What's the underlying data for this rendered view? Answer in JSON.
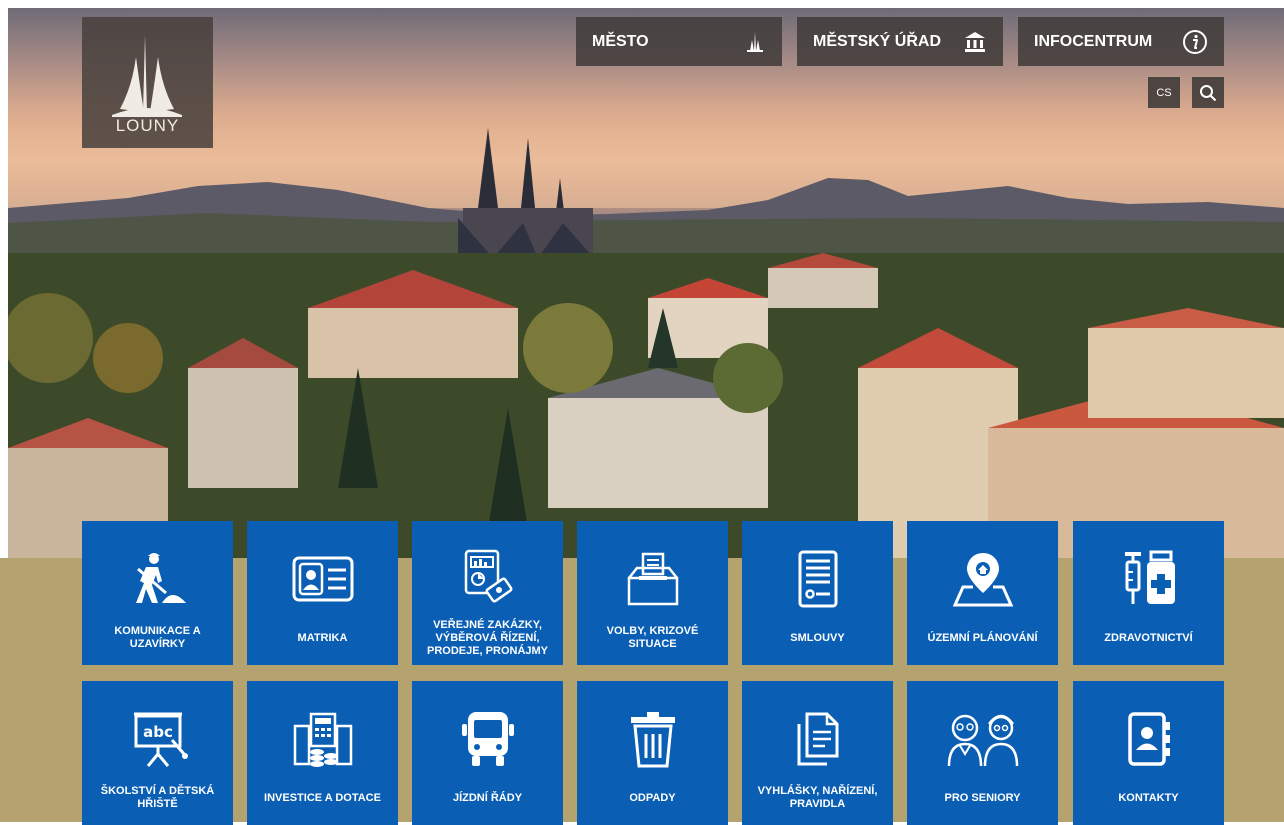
{
  "logo": {
    "text": "LOUNY"
  },
  "nav": [
    {
      "label": "MĚSTO",
      "icon": "cathedral-icon"
    },
    {
      "label": "MĚSTSKÝ ÚŘAD",
      "icon": "town-hall-icon"
    },
    {
      "label": "INFOCENTRUM",
      "icon": "info-icon"
    }
  ],
  "lang": {
    "label": "CS"
  },
  "colors": {
    "tile": "#0a5fb4",
    "band": "#b4a36f"
  },
  "tiles": [
    {
      "label": "KOMUNIKACE A UZAVÍRKY",
      "icon": "road-worker-icon"
    },
    {
      "label": "MATRIKA",
      "icon": "id-card-icon"
    },
    {
      "label": "VEŘEJNÉ ZAKÁZKY, VÝBĚROVÁ ŘÍZENÍ, PRODEJE, PRONÁJMY",
      "icon": "report-icon"
    },
    {
      "label": "VOLBY, KRIZOVÉ SITUACE",
      "icon": "ballot-box-icon"
    },
    {
      "label": "SMLOUVY",
      "icon": "contract-icon"
    },
    {
      "label": "ÚZEMNÍ PLÁNOVÁNÍ",
      "icon": "map-pin-icon"
    },
    {
      "label": "ZDRAVOTNICTVÍ",
      "icon": "medicine-icon"
    },
    {
      "label": "ŠKOLSTVÍ A DĚTSKÁ HŘIŠTĚ",
      "icon": "blackboard-icon"
    },
    {
      "label": "INVESTICE A DOTACE",
      "icon": "investment-icon"
    },
    {
      "label": "JÍZDNÍ ŘÁDY",
      "icon": "bus-icon"
    },
    {
      "label": "ODPADY",
      "icon": "trash-bin-icon"
    },
    {
      "label": "VYHLÁŠKY, NAŘÍZENÍ, PRAVIDLA",
      "icon": "documents-icon"
    },
    {
      "label": "PRO SENIORY",
      "icon": "seniors-icon"
    },
    {
      "label": "KONTAKTY",
      "icon": "contacts-icon"
    }
  ]
}
